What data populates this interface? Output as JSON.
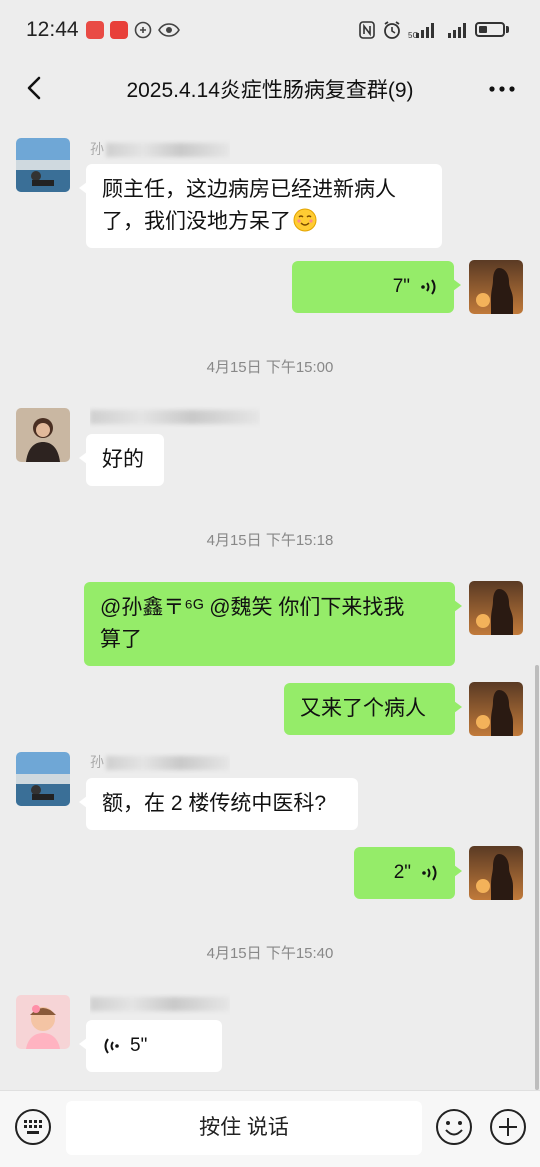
{
  "status_bar": {
    "time": "12:44",
    "network_label": "5G"
  },
  "header": {
    "title": "2025.4.14炎症性肠病复查群(9)"
  },
  "messages": [
    {
      "name": "孙",
      "text_line1": "顾主任，这边病房已经进新病人",
      "text_line2": "了，我们没地方呆了"
    },
    {
      "duration": "7\""
    },
    {
      "timestamp": "4月15日 下午15:00"
    },
    {
      "text": "好的"
    },
    {
      "timestamp": "4月15日 下午15:18"
    },
    {
      "text_line1": "@孙鑫〒⁶ᴳ @魏笑 你们下来找我",
      "text_line2": "算了"
    },
    {
      "text": "又来了个病人"
    },
    {
      "name": "孙",
      "text": "额，在 2 楼传统中医科?"
    },
    {
      "duration": "2\""
    },
    {
      "timestamp": "4月15日 下午15:40"
    },
    {
      "duration": "5\""
    }
  ],
  "input_bar": {
    "hold_to_talk": "按住 说话"
  },
  "icons": [
    "back-arrow-icon",
    "more-icon",
    "keyboard-icon",
    "emoji-icon",
    "plus-icon",
    "voice-wave-icon"
  ]
}
